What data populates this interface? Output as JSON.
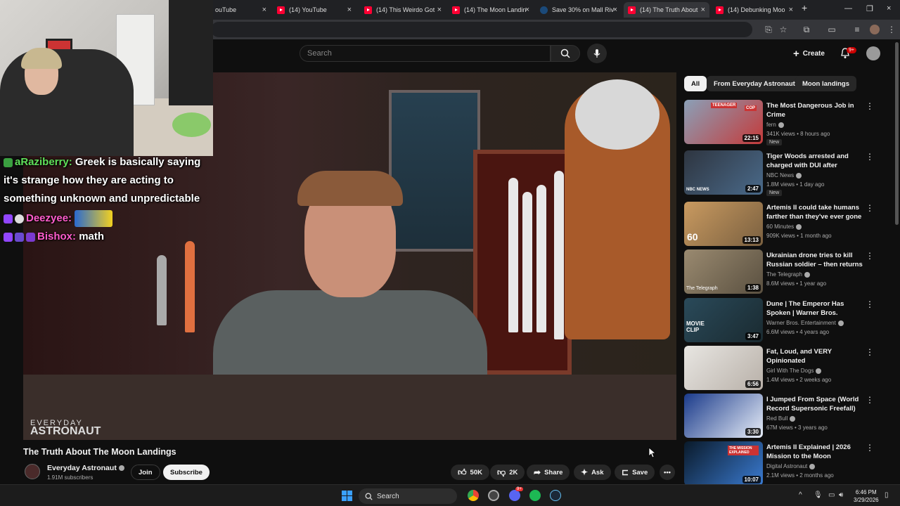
{
  "browser": {
    "tabs": [
      {
        "label": "YouTube",
        "partial": "ouTube",
        "icon": "youtube-icon"
      },
      {
        "label": "(14) YouTube",
        "icon": "youtube-icon"
      },
      {
        "label": "(14) This Weirdo Got",
        "icon": "youtube-icon"
      },
      {
        "label": "(14) The Moon Landin",
        "icon": "youtube-icon"
      },
      {
        "label": "Save 30% on Mall Riv",
        "icon": "steam-icon"
      },
      {
        "label": "(14) The Truth About",
        "icon": "youtube-icon",
        "active": true
      },
      {
        "label": "(14) Debunking Moo",
        "icon": "youtube-icon"
      }
    ],
    "new_tab": "+",
    "close": "×"
  },
  "youtube": {
    "search_placeholder": "Search",
    "create_label": "Create",
    "notifications": "9+"
  },
  "stream": {
    "chat": [
      {
        "user": "aRaziberry:",
        "text": "Greek is basically saying it's strange how they are acting to something unknown and unpredictable"
      },
      {
        "user": "Deezyee:",
        "text": ""
      },
      {
        "user": "Bishox:",
        "text": "math"
      }
    ]
  },
  "video": {
    "watermark_line1": "EVERYDAY",
    "watermark_line2": "ASTRONAUT",
    "title": "The Truth About The Moon Landings",
    "channel": "Everyday Astronaut",
    "subscribers": "1.91M subscribers",
    "join": "Join",
    "subscribe": "Subscribe",
    "likes": "50K",
    "dislikes": "2K",
    "share": "Share",
    "ask": "Ask",
    "save": "Save"
  },
  "chips": [
    "All",
    "From Everyday Astronaut",
    "Moon landings"
  ],
  "recommendations": [
    {
      "title": "The Most Dangerous Job in Crime",
      "channel": "fern",
      "meta": "341K views • 8 hours ago",
      "duration": "22:15",
      "badge": "New",
      "thumb": [
        "#8aa0b8",
        "#c43a3a"
      ]
    },
    {
      "title": "Tiger Woods arrested and charged with DUI after rollover...",
      "channel": "NBC News",
      "meta": "1.8M views • 1 day ago",
      "duration": "2:47",
      "badge": "New",
      "thumb": [
        "#2e3540",
        "#4a6a8a"
      ]
    },
    {
      "title": "Artemis II could take humans farther than they've ever gone ...",
      "channel": "60 Minutes",
      "meta": "909K views • 1 month ago",
      "duration": "13:13",
      "badge": "",
      "thumb": [
        "#c99a60",
        "#7a6040"
      ]
    },
    {
      "title": "Ukrainian drone tries to kill Russian soldier – then returns ...",
      "channel": "The Telegraph",
      "meta": "8.6M views • 1 year ago",
      "duration": "1:38",
      "badge": "",
      "thumb": [
        "#9a8a70",
        "#5a5040"
      ]
    },
    {
      "title": "Dune | The Emperor Has Spoken | Warner Bros. Entertainment",
      "channel": "Warner Bros. Entertainment",
      "meta": "6.6M views • 4 years ago",
      "duration": "3:47",
      "badge": "",
      "thumb": [
        "#2a4a5a",
        "#1a2a30"
      ]
    },
    {
      "title": "Fat, Loud, and VERY Opinionated",
      "channel": "Girl With The Dogs",
      "meta": "1.4M views • 2 weeks ago",
      "duration": "6:56",
      "badge": "",
      "thumb": [
        "#e8e6e2",
        "#b8b0a8"
      ]
    },
    {
      "title": "I Jumped From Space (World Record Supersonic Freefall)",
      "channel": "Red Bull",
      "meta": "67M views • 3 years ago",
      "duration": "3:30",
      "badge": "",
      "thumb": [
        "#1a3a8a",
        "#e8eef8"
      ]
    },
    {
      "title": "Artemis II Explained | 2026 Mission to the Moon",
      "channel": "Digital Astronaut",
      "meta": "2.1M views • 2 months ago",
      "duration": "10:07",
      "badge": "",
      "thumb": [
        "#0a1a2a",
        "#3a7ad0"
      ]
    }
  ],
  "thumb_text": {
    "teenager": "TEENAGER",
    "cop": "COP",
    "nbc": "NBC NEWS",
    "sixty": "60",
    "telegraph": "The Telegraph",
    "movie_clip": "MOVIE CLIP",
    "mission": "THE MISSION EXPLAINED"
  },
  "taskbar": {
    "search": "Search",
    "time": "6:46 PM",
    "date": "3/29/2026",
    "discord_badge": "9+"
  }
}
